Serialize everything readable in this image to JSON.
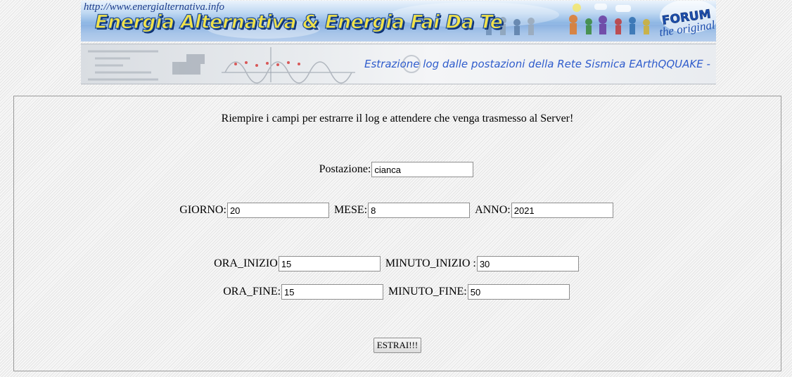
{
  "header": {
    "url": "http://www.energialternativa.info",
    "title": "Energia Alternativa & Energia Fai Da Te",
    "forum_badge": "FORUM",
    "forum_tagline": "the original",
    "subtitle": "Estrazione log dalle postazioni della Rete Sismica EArthQQUAKE -"
  },
  "form": {
    "instructions": "Riempire i campi per estrarre il log e attendere che venga trasmesso al Server!",
    "postazione": {
      "label": "Postazione:",
      "value": "cianca"
    },
    "giorno": {
      "label": "GIORNO:",
      "value": "20"
    },
    "mese": {
      "label": "MESE:",
      "value": "8"
    },
    "anno": {
      "label": "ANNO:",
      "value": "2021"
    },
    "ora_inizio": {
      "label": "ORA_INIZIO",
      "value": "15"
    },
    "minuto_inizio": {
      "label": "MINUTO_INIZIO :",
      "value": "30"
    },
    "ora_fine": {
      "label": "ORA_FINE:",
      "value": "15"
    },
    "minuto_fine": {
      "label": "MINUTO_FINE:",
      "value": "50"
    },
    "submit_label": "ESTRAI!!!"
  },
  "colors": {
    "page_background": "#f4f4f4",
    "panel_border": "#9a9a9a",
    "banner_title": "#f2e24a",
    "banner_subtitle": "#2f5ccc"
  }
}
